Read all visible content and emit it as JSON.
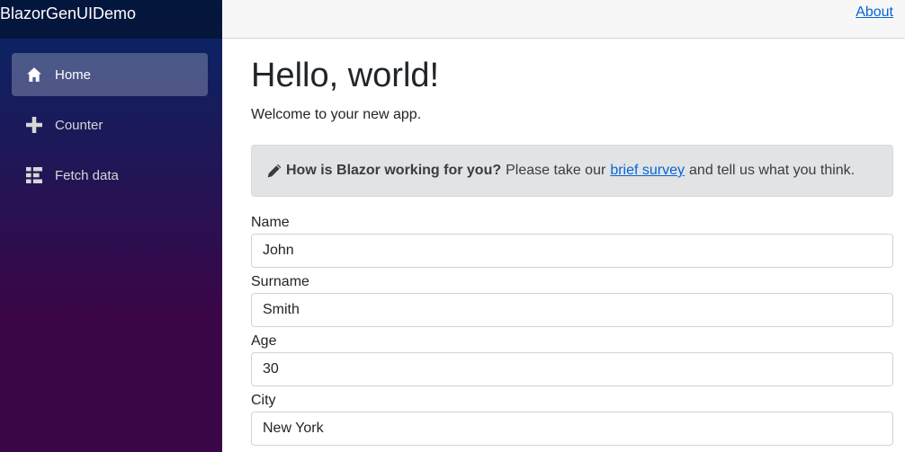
{
  "app": {
    "brand": "BlazorGenUIDemo"
  },
  "topbar": {
    "about_label": "About"
  },
  "sidebar": {
    "items": [
      {
        "label": "Home",
        "icon": "home-icon",
        "active": true
      },
      {
        "label": "Counter",
        "icon": "plus-icon",
        "active": false
      },
      {
        "label": "Fetch data",
        "icon": "list-rich-icon",
        "active": false
      }
    ]
  },
  "main": {
    "title": "Hello, world!",
    "welcome": "Welcome to your new app.",
    "survey": {
      "icon": "pencil-icon",
      "question": "How is Blazor working for you?",
      "text_before": "Please take our",
      "link_label": "brief survey",
      "text_after": "and tell us what you think."
    },
    "form": {
      "fields": [
        {
          "label": "Name",
          "value": "John"
        },
        {
          "label": "Surname",
          "value": "Smith"
        },
        {
          "label": "Age",
          "value": "30"
        },
        {
          "label": "City",
          "value": "New York"
        }
      ]
    }
  },
  "colors": {
    "sidebar_top": "#052767",
    "sidebar_bottom": "#3a0647",
    "link": "#0366d6",
    "topbar_bg": "#f7f7f7",
    "alert_bg": "#e2e3e5"
  }
}
